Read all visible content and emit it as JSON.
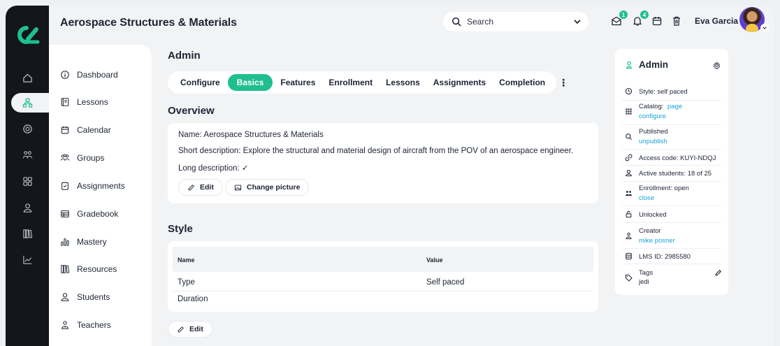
{
  "app": {
    "title": "Aerospace Structures & Materials"
  },
  "search": {
    "placeholder": "Search"
  },
  "header": {
    "inbox_badge": "1",
    "notifications_badge": "4",
    "user_name": "Eva Garcia"
  },
  "sidebar": {
    "items": [
      {
        "label": "Dashboard",
        "icon": "info-icon"
      },
      {
        "label": "Lessons",
        "icon": "book-icon"
      },
      {
        "label": "Calendar",
        "icon": "calendar-icon"
      },
      {
        "label": "Groups",
        "icon": "groups-icon"
      },
      {
        "label": "Assignments",
        "icon": "assignment-icon"
      },
      {
        "label": "Gradebook",
        "icon": "table-icon"
      },
      {
        "label": "Mastery",
        "icon": "bars-icon"
      },
      {
        "label": "Resources",
        "icon": "library-icon"
      },
      {
        "label": "Students",
        "icon": "user-icon"
      },
      {
        "label": "Teachers",
        "icon": "teacher-icon"
      }
    ]
  },
  "main": {
    "page_title": "Admin",
    "tabs": [
      {
        "label": "Configure"
      },
      {
        "label": "Basics"
      },
      {
        "label": "Features"
      },
      {
        "label": "Enrollment"
      },
      {
        "label": "Lessons"
      },
      {
        "label": "Assignments"
      },
      {
        "label": "Completion"
      }
    ],
    "more": "⋮",
    "overview": {
      "title": "Overview",
      "name": "Name: Aerospace Structures & Materials",
      "short_description": "Short description: Explore the structural and material design of aircraft from the POV of an aerospace engineer.",
      "long_description": "Long description: ✓",
      "edit_label": "Edit",
      "change_picture_label": "Change picture"
    },
    "style": {
      "title": "Style",
      "col_name": "Name",
      "col_value": "Value",
      "rows": [
        {
          "name": "Type",
          "value": "Self paced"
        },
        {
          "name": "Duration",
          "value": ""
        }
      ],
      "edit_label": "Edit"
    }
  },
  "panel": {
    "title": "Admin",
    "style": "Style: self paced",
    "catalog_label": "Catalog:",
    "catalog_link": "page",
    "catalog_configure": "configure",
    "published": "Published",
    "unpublish": "unpublish",
    "access_code": "Access code: KUYI-NDQJ",
    "active_students": "Active students: 18 of 25",
    "enrollment": "Enrollment: open",
    "enrollment_close": "close",
    "unlocked": "Unlocked",
    "creator_label": "Creator",
    "creator_name": "mike posner",
    "lms_id": "LMS ID: 2985580",
    "tags_label": "Tags",
    "tags_value": "jedi"
  },
  "colors": {
    "accent": "#1fbf8f",
    "link": "#1aa3d9",
    "rail": "#14161c",
    "background": "#f2f3f5"
  }
}
